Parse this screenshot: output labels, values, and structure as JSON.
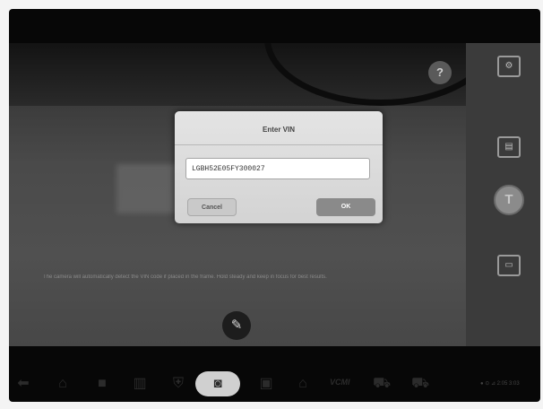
{
  "camera": {
    "help_glyph": "?",
    "hint_text": "The camera will automatically detect the VIN code if placed in the frame. Hold steady and keep in focus for best results.",
    "edit_glyph": "✎"
  },
  "side_panel": {
    "settings_glyph": "⚙",
    "scan_glyph": "▤",
    "capture_glyph": "T",
    "ocr_glyph": "▭"
  },
  "dialog": {
    "title": "Enter VIN",
    "vin_value": "LGBH52E05FY300027",
    "cancel_label": "Cancel",
    "ok_label": "OK"
  },
  "taskbar": {
    "back_glyph": "⬅",
    "home_glyph": "⌂",
    "stop_glyph": "■",
    "tasks_glyph": "▥",
    "shield_glyph": "⛨",
    "camera_glyph": "◙",
    "screen_glyph": "▣",
    "house_glyph": "⌂",
    "vcmi_label": "VCMI",
    "car_glyph": "⛟",
    "cars_glyph": "⛟",
    "status_text": "● ⊙ ⊿ 2:05 3:03"
  }
}
